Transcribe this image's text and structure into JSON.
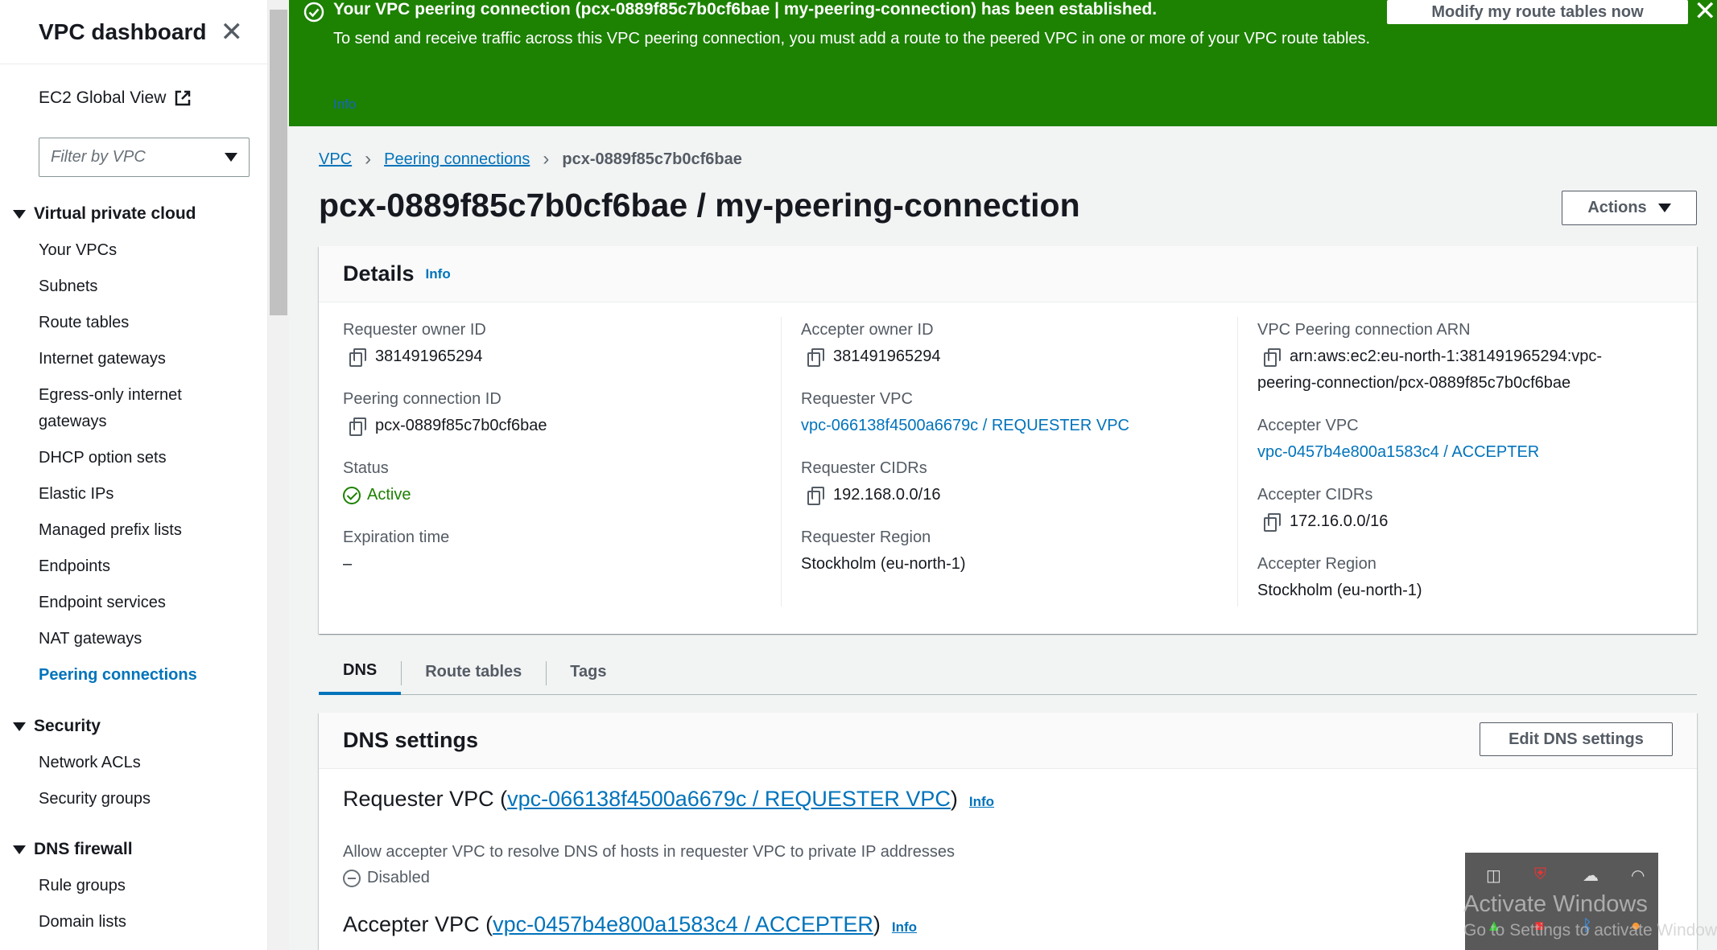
{
  "sidebar": {
    "title": "VPC dashboard",
    "global_view": "EC2 Global View",
    "filter_placeholder": "Filter by VPC",
    "sections": {
      "vpc": "Virtual private cloud",
      "security": "Security",
      "dns_firewall": "DNS firewall"
    },
    "vpc_items": [
      "Your VPCs",
      "Subnets",
      "Route tables",
      "Internet gateways",
      "Egress-only internet",
      "gateways",
      "DHCP option sets",
      "Elastic IPs",
      "Managed prefix lists",
      "Endpoints",
      "Endpoint services",
      "NAT gateways",
      "Peering connections"
    ],
    "security_items": [
      "Network ACLs",
      "Security groups"
    ],
    "dns_items": [
      "Rule groups",
      "Domain lists"
    ]
  },
  "flash": {
    "title": "Your VPC peering connection (pcx-0889f85c7b0cf6bae | my-peering-connection) has been established.",
    "body": "To send and receive traffic across this VPC peering connection, you must add a route to the peered VPC in one or more of your VPC route tables.",
    "info": "Info",
    "button": "Modify my route tables now",
    "color": "#1d8102"
  },
  "breadcrumb": [
    "VPC",
    "Peering connections",
    "pcx-0889f85c7b0cf6bae"
  ],
  "page_title": "pcx-0889f85c7b0cf6bae / my-peering-connection",
  "actions_label": "Actions",
  "details": {
    "title": "Details",
    "info": "Info",
    "requester_owner_label": "Requester owner ID",
    "requester_owner": "381491965294",
    "peering_id_label": "Peering connection ID",
    "peering_id": "pcx-0889f85c7b0cf6bae",
    "status_label": "Status",
    "status": "Active",
    "expiration_label": "Expiration time",
    "expiration": "–",
    "accepter_owner_label": "Accepter owner ID",
    "accepter_owner": "381491965294",
    "requester_vpc_label": "Requester VPC",
    "requester_vpc": "vpc-066138f4500a6679c / REQUESTER VPC",
    "requester_cidrs_label": "Requester CIDRs",
    "requester_cidrs": "192.168.0.0/16",
    "requester_region_label": "Requester Region",
    "requester_region": "Stockholm (eu-north-1)",
    "arn_label": "VPC Peering connection ARN",
    "arn_line1": "arn:aws:ec2:eu-north-1:381491965294:vpc-",
    "arn_line2": "peering-connection/pcx-0889f85c7b0cf6bae",
    "accepter_vpc_label": "Accepter VPC",
    "accepter_vpc": "vpc-0457b4e800a1583c4 / ACCEPTER",
    "accepter_cidrs_label": "Accepter CIDRs",
    "accepter_cidrs": "172.16.0.0/16",
    "accepter_region_label": "Accepter Region",
    "accepter_region": "Stockholm (eu-north-1)"
  },
  "tabs": [
    "DNS",
    "Route tables",
    "Tags"
  ],
  "dns": {
    "title": "DNS settings",
    "edit_button": "Edit DNS settings",
    "requester_prefix": "Requester VPC (",
    "requester_link": "vpc-066138f4500a6679c / REQUESTER VPC",
    "suffix": ")",
    "info": "Info",
    "allow_label": "Allow accepter VPC to resolve DNS of hosts in requester VPC to private IP addresses",
    "allow_value": "Disabled",
    "accepter_prefix": "Accepter VPC (",
    "accepter_link": "vpc-0457b4e800a1583c4 / ACCEPTER"
  },
  "overlay": {
    "watermark": "Activate Windows",
    "watermark_sub": "Go to Settings to activate Windows."
  }
}
